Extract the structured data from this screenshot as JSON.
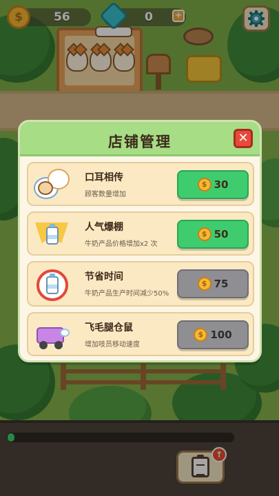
{
  "hud": {
    "coins": "56",
    "gems": "0",
    "coin_icon": "coin-icon",
    "gem_icon": "gem-icon",
    "plus_icon": "plus-icon",
    "settings_icon": "gear-icon"
  },
  "modal": {
    "title": "店铺管理",
    "close_label": "✕",
    "items": [
      {
        "name": "口耳相传",
        "desc": "顾客数量增加",
        "price": "30",
        "affordable": true,
        "icon": "word-of-mouth-icon"
      },
      {
        "name": "人气爆棚",
        "desc": "牛奶产品价格增加x2 次",
        "price": "50",
        "affordable": true,
        "icon": "popularity-star-icon"
      },
      {
        "name": "节省时间",
        "desc": "牛奶产品生产时间减少50%",
        "price": "75",
        "affordable": false,
        "icon": "time-clock-icon"
      },
      {
        "name": "飞毛腿仓鼠",
        "desc": "增加吱员移动速度",
        "price": "100",
        "affordable": false,
        "icon": "delivery-truck-icon"
      }
    ],
    "coin_symbol": "$"
  },
  "bottom": {
    "progress": 0.03,
    "clipboard_icon": "clipboard-icon",
    "badge_icon": "arrow-up-icon",
    "badge_label": "↑"
  },
  "colors": {
    "affordable": "#3fcc6f",
    "unaffordable": "#8f8e92",
    "header": "#a6dd85",
    "close": "#e8493a"
  }
}
